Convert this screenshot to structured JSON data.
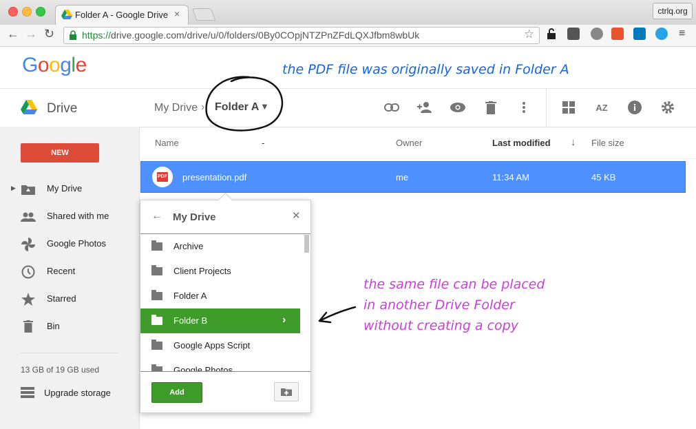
{
  "browser": {
    "tab_title": "Folder A - Google Drive",
    "tab_close": "×",
    "profile": "ctrlq.org",
    "url_protocol": "https://",
    "url_rest": "drive.google.com/drive/u/0/folders/0By0COpjNTZPnZFdLQXJfbm8wbUk"
  },
  "google_logo": "Google",
  "annotations": {
    "top": "the PDF file was originally saved in Folder A",
    "side": [
      "the same file can be placed",
      "in another Drive Folder",
      "without creating a copy"
    ]
  },
  "drive": {
    "label": "Drive",
    "breadcrumb": {
      "root": "My Drive",
      "separator": "›",
      "current": "Folder A"
    }
  },
  "sidebar": {
    "new_button": "NEW",
    "items": [
      {
        "label": "My Drive",
        "icon": "my-drive-icon"
      },
      {
        "label": "Shared with me",
        "icon": "people-icon"
      },
      {
        "label": "Google Photos",
        "icon": "photos-icon"
      },
      {
        "label": "Recent",
        "icon": "clock-icon"
      },
      {
        "label": "Starred",
        "icon": "star-icon"
      },
      {
        "label": "Bin",
        "icon": "trash-icon"
      }
    ],
    "storage": "13 GB of 19 GB used",
    "upgrade": "Upgrade storage"
  },
  "columns": {
    "name": "Name",
    "dash": "-",
    "owner": "Owner",
    "modified": "Last modified",
    "size": "File size"
  },
  "file": {
    "name": "presentation.pdf",
    "owner": "me",
    "modified": "11:34 AM",
    "size": "45 KB",
    "badge": "PDF"
  },
  "move_dialog": {
    "title": "My Drive",
    "folders": [
      "Archive",
      "Client Projects",
      "Folder A",
      "Folder B",
      "Google Apps Script",
      "Google Photos"
    ],
    "selected": "Folder B",
    "add_button": "Add"
  },
  "colors": {
    "selection": "#4d90fe",
    "new_button": "#dd4b39",
    "selected_folder": "#3f9b2a",
    "annotation_blue": "#1565e0",
    "annotation_purple": "#cc3ddb"
  }
}
